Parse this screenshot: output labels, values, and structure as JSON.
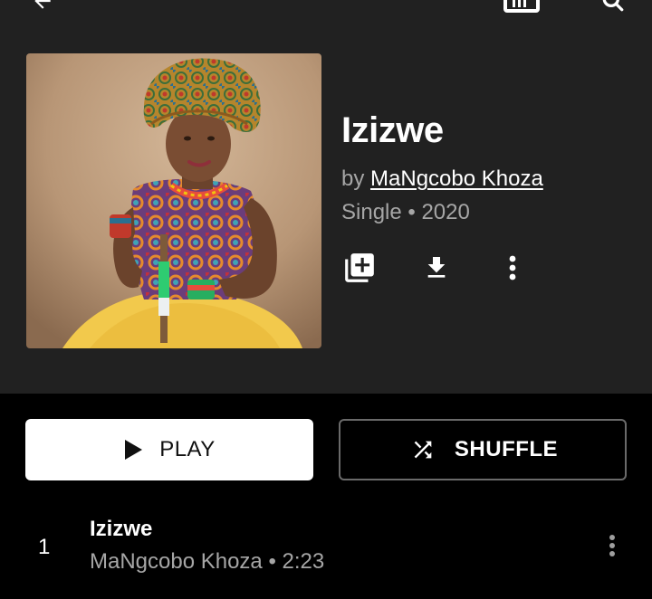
{
  "album": {
    "title": "Izizwe",
    "by_prefix": "by ",
    "artist": "MaNgcobo Khoza",
    "meta": "Single • 2020"
  },
  "icons": {
    "back": "arrow-back-icon",
    "cast": "cast-icon",
    "search": "search-icon",
    "add_to_library": "library-add-icon",
    "download": "download-icon",
    "more": "more-vert-icon",
    "play": "play-icon",
    "shuffle": "shuffle-icon"
  },
  "buttons": {
    "play_label": "PLAY",
    "shuffle_label": "SHUFFLE"
  },
  "tracks": [
    {
      "number": "1",
      "title": "Izizwe",
      "subtitle": "MaNgcobo Khoza • 2:23"
    }
  ],
  "colors": {
    "header_bg": "#212121",
    "page_bg": "#000000",
    "secondary_text": "#a6a6a6",
    "play_button_bg": "#ffffff",
    "shuffle_border": "#6a6a6a"
  }
}
